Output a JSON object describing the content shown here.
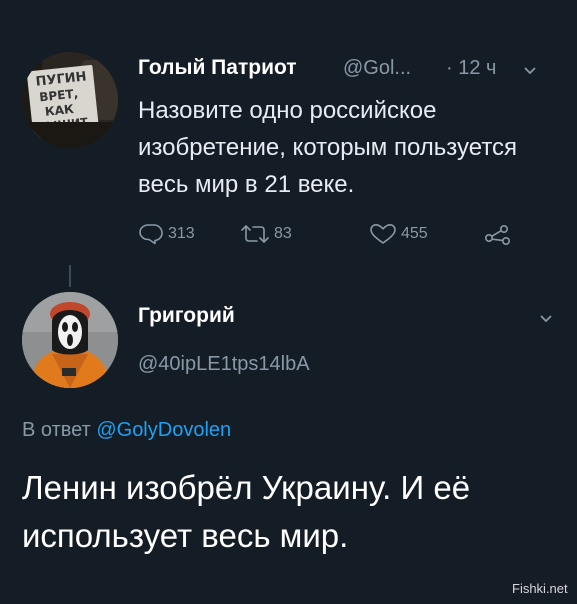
{
  "tweet_original": {
    "display_name": "Голый Патриот",
    "handle": "@Gol...",
    "time": "· 12 ч",
    "text": "Назовите одно российское изобретение, которым пользуется весь мир в 21 веке.",
    "avatar_sign_lines": [
      "ПУГИН",
      "ВРЕТ,",
      "КАК",
      "ДЫШИТ."
    ],
    "actions": {
      "replies": "313",
      "retweets": "83",
      "likes": "455"
    }
  },
  "tweet_reply": {
    "display_name": "Григорий",
    "handle": "@40ipLE1tps14lbA",
    "reply_prefix": "В ответ",
    "reply_mention": "@GolyDovolen",
    "text": "Ленин изобрёл Украину. И её использует весь мир."
  },
  "watermark": "Fishki.net",
  "colors": {
    "background": "#141c26",
    "secondary_text": "#8899a6",
    "mention": "#1da1f2",
    "primary_text": "#ffffff"
  },
  "icons": [
    "reply-icon",
    "retweet-icon",
    "like-icon",
    "share-icon",
    "chevron-down-icon"
  ]
}
